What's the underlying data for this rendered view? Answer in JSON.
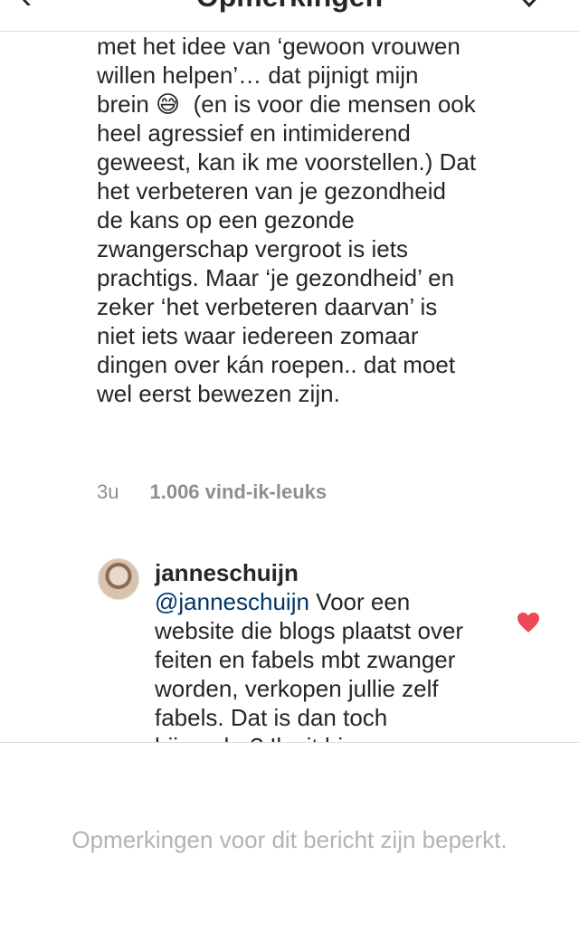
{
  "header": {
    "title": "Opmerkingen",
    "back_icon": "back-arrow-icon",
    "share_icon": "paper-plane-icon"
  },
  "comment": {
    "text": "met het idee van ‘gewoon vrouwen willen helpen’… dat pijnigt mijn brein 😅  (en is voor die mensen ook heel agressief en intimiderend geweest, kan ik me voorstellen.) Dat het verbeteren van je gezondheid de kans op een gezonde zwangerschap vergroot is iets prachtigs. Maar ‘je gezondheid’ en zeker ‘het verbeteren daarvan’ is niet iets waar iedereen zomaar dingen over kán roepen.. dat moet wel eerst bewezen zijn.",
    "age": "3u",
    "likes": "1.006 vind-ik-leuks"
  },
  "reply": {
    "username": "janneschuijn",
    "mention": "@janneschuijn",
    "text": " Voor een website die blogs plaatst over feiten en fabels mbt zwanger worden, verkopen jullie zelf fabels. Dat is dan toch bijzonder? Ik zit hier",
    "liked": true,
    "heart_color": "#ed4956"
  },
  "footer": {
    "restricted_text": "Opmerkingen voor dit bericht zijn beperkt."
  }
}
